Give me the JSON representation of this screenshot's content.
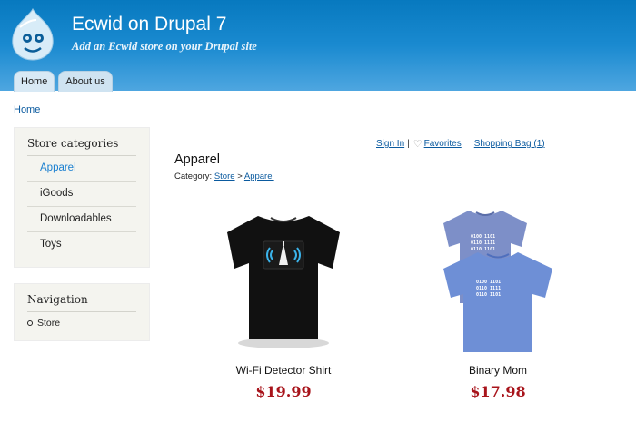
{
  "site": {
    "name": "Ecwid on Drupal 7",
    "slogan": "Add an Ecwid store on your Drupal site"
  },
  "tabs": [
    {
      "label": "Home"
    },
    {
      "label": "About us"
    }
  ],
  "breadcrumb": "Home",
  "sidebar": {
    "categories_title": "Store categories",
    "categories": [
      {
        "label": "Apparel",
        "active": true
      },
      {
        "label": "iGoods"
      },
      {
        "label": "Downloadables"
      },
      {
        "label": "Toys"
      }
    ],
    "navigation_title": "Navigation",
    "navigation": [
      {
        "label": "Store"
      }
    ]
  },
  "store": {
    "sign_in": "Sign In",
    "separator": "|",
    "favorites": "Favorites",
    "shopping_bag": "Shopping Bag (1)",
    "title": "Apparel",
    "category_prefix": "Category:",
    "path": [
      "Store",
      "Apparel"
    ],
    "path_separator": ">",
    "products": [
      {
        "name": "Wi-Fi Detector Shirt",
        "price": "$19.99"
      },
      {
        "name": "Binary Mom",
        "price": "$17.98"
      }
    ]
  },
  "colors": {
    "header_blue": "#1a8ad0",
    "link_blue": "#0a5a9f",
    "price_red": "#a8141b",
    "sidebar_bg": "#f4f4ef"
  }
}
